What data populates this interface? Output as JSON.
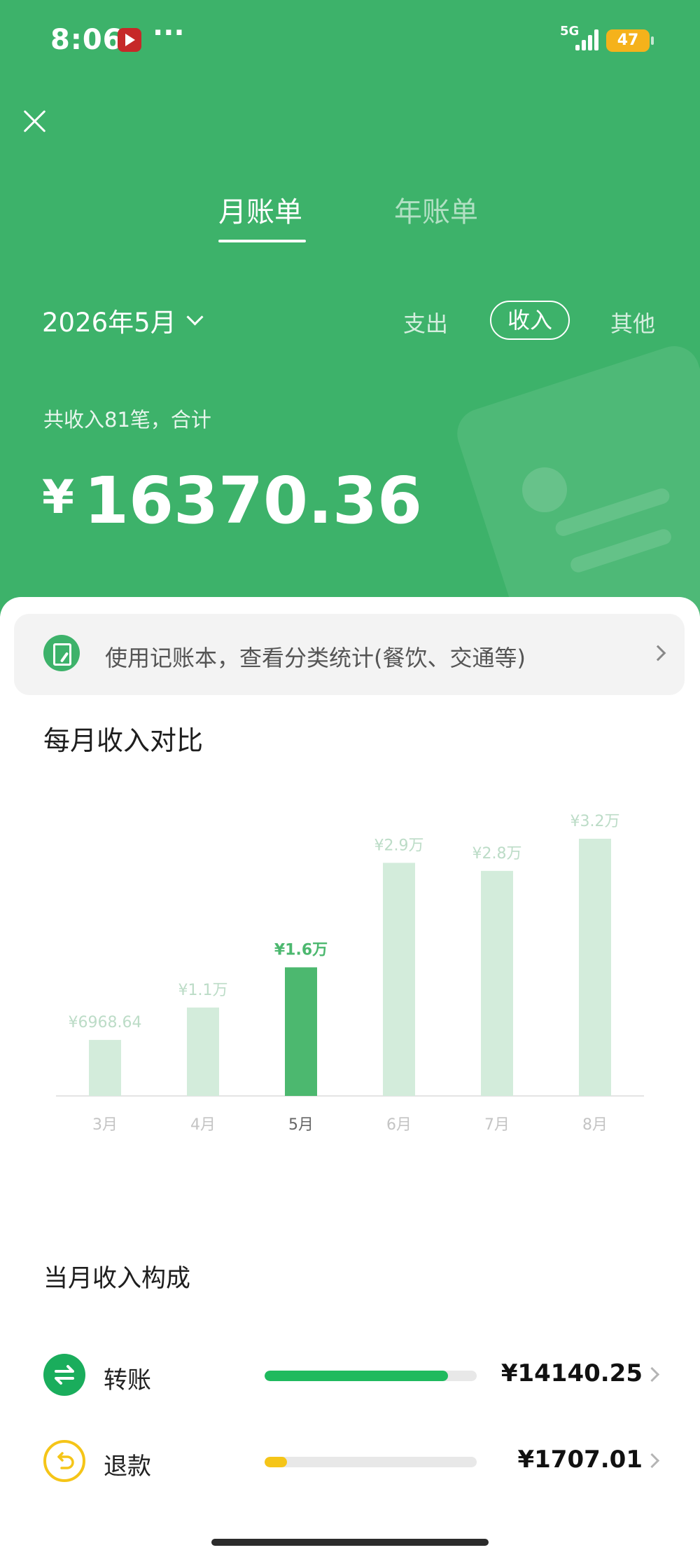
{
  "status_bar": {
    "time": "8:06",
    "more": "···",
    "network": "5G",
    "battery": "47"
  },
  "header": {
    "tabs": [
      "月账单",
      "年账单"
    ],
    "active_tab": "月账单",
    "month": "2026年5月",
    "filters": [
      "支出",
      "收入",
      "其他"
    ],
    "active_filter": "收入",
    "summary": "共收入81笔，合计",
    "total_currency": "¥",
    "total_value": "16370.36"
  },
  "promo": {
    "text": "使用记账本，查看分类统计(餐饮、交通等)"
  },
  "compare_section": {
    "title": "每月收入对比"
  },
  "chart_data": {
    "type": "bar",
    "title": "每月收入对比",
    "categories": [
      "3月",
      "4月",
      "5月",
      "6月",
      "7月",
      "8月"
    ],
    "values": [
      6968.64,
      11000,
      16000,
      29000,
      28000,
      32000
    ],
    "labels": [
      "¥6968.64",
      "¥1.1万",
      "¥1.6万",
      "¥2.9万",
      "¥2.8万",
      "¥3.2万"
    ],
    "highlight_index": 2,
    "ylim": [
      0,
      34000
    ],
    "grid": false,
    "colors": {
      "bar": "#d3ecdb",
      "bar_active": "#4cb86f",
      "label": "#bcdcc7",
      "label_active": "#4cb86f",
      "tick": "#c4c4c4",
      "tick_active": "#666666",
      "baseline": "#e4e4e4"
    }
  },
  "composition": {
    "title": "当月收入构成",
    "items": [
      {
        "name": "转账",
        "amount": "¥14140.25",
        "share": 0.864,
        "color": "#1fba5e",
        "icon": "transfer-arrows-icon"
      },
      {
        "name": "退款",
        "amount": "¥1707.01",
        "share": 0.104,
        "color": "#f5c518",
        "icon": "refund-return-icon"
      }
    ]
  },
  "colors": {
    "header_green": "#3db26a",
    "white": "#ffffff"
  }
}
